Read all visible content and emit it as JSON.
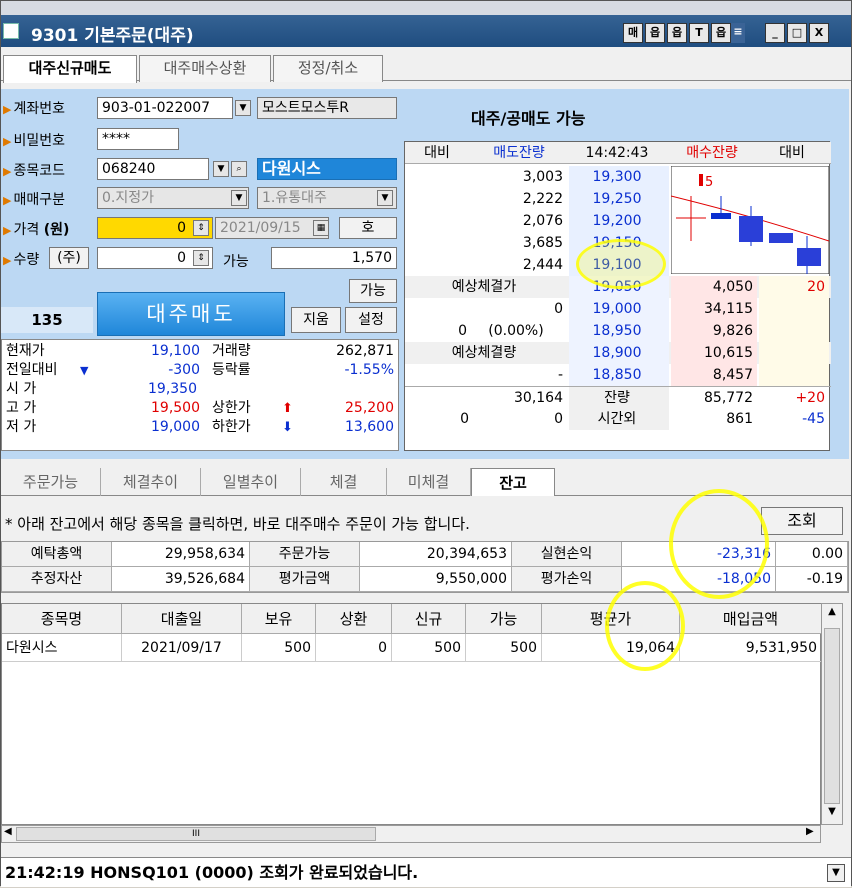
{
  "window": {
    "title": "9301 기본주문(대주)",
    "title_buttons": [
      "매",
      "읍",
      "읍",
      "T",
      "읍",
      "≡",
      "_",
      "□",
      "X"
    ]
  },
  "top_tabs": [
    "대주신규매도",
    "대주매수상환",
    "정정/취소"
  ],
  "form": {
    "account_label": "계좌번호",
    "account_value": "903-01-022007",
    "account_name": "모스트모스투R",
    "password_label": "비밀번호",
    "password_value": "****",
    "code_label": "종목코드",
    "code_value": "068240",
    "stock_name": "다원시스",
    "trade_type_label": "매매구분",
    "trade_type_value": "0.지정가",
    "stock_type_value": "1.유통대주",
    "price_label": "가격",
    "price_unit": "(원)",
    "price_value": "0",
    "date_value": "2021/09/15",
    "ho_label": "호",
    "qty_label": "수량",
    "qty_unit": "(주)",
    "qty_value": "0",
    "avail_label": "가능",
    "avail_value": "1,570",
    "avail_btn": "가능",
    "count_value": "135",
    "sell_btn": "대주매도",
    "clear_btn": "지움",
    "setting_btn": "설정"
  },
  "quote_info": {
    "rows": [
      {
        "label": "현재가",
        "value": "19,100",
        "label2": "거래량",
        "value2": "262,871"
      },
      {
        "label": "전일대비",
        "value": "-300",
        "label2": "등락률",
        "value2": "-1.55%"
      },
      {
        "label": "시  가",
        "value": "19,350",
        "label2": "",
        "value2": ""
      },
      {
        "label": "고  가",
        "value": "19,500",
        "label2": "상한가",
        "value2": "25,200"
      },
      {
        "label": "저  가",
        "value": "19,000",
        "label2": "하한가",
        "value2": "13,600"
      }
    ]
  },
  "orderbook": {
    "title": "대주/공매도 가능",
    "headers": [
      "대비",
      "매도잔량",
      "14:42:43",
      "매수잔량",
      "대비"
    ],
    "asks": [
      {
        "qty": "3,003",
        "price": "19,300"
      },
      {
        "qty": "2,222",
        "price": "19,250"
      },
      {
        "qty": "2,076",
        "price": "19,200"
      },
      {
        "qty": "3,685",
        "price": "19,150"
      },
      {
        "qty": "2,444",
        "price": "19,100"
      }
    ],
    "bids": [
      {
        "price": "19,050",
        "qty": "4,050",
        "diff": "20"
      },
      {
        "price": "19,000",
        "qty": "34,115",
        "diff": ""
      },
      {
        "price": "18,950",
        "qty": "9,826",
        "diff": ""
      },
      {
        "price": "18,900",
        "qty": "10,615",
        "diff": ""
      },
      {
        "price": "18,850",
        "qty": "8,457",
        "diff": ""
      }
    ],
    "exp_price_label": "예상체결가",
    "exp_price_value": "0",
    "exp_change": "0",
    "exp_rate": "(0.00%)",
    "exp_qty_label": "예상체결량",
    "exp_qty_value": "-",
    "ask_total": "30,164",
    "remain_label": "잔량",
    "bid_total": "85,772",
    "bid_total_diff": "+20",
    "after_left": "0",
    "after_mid": "0",
    "after_label": "시간외",
    "after_bid": "861",
    "after_diff": "-45",
    "chart_marker": "5"
  },
  "bottom_tabs": [
    "주문가능",
    "체결추이",
    "일별추이",
    "체결",
    "미체결",
    "잔고"
  ],
  "notice": "* 아래 잔고에서 해당 종목을 클릭하면, 바로 대주매수 주문이 가능 합니다.",
  "query_btn": "조회",
  "summary": {
    "row1": [
      "예탁총액",
      "29,958,634",
      "주문가능",
      "20,394,653",
      "실현손익",
      "",
      "-23,316",
      "0.00"
    ],
    "row2": [
      "추정자산",
      "39,526,684",
      "평가금액",
      "9,550,000",
      "평가손익",
      "",
      "-18,050",
      "-0.19"
    ]
  },
  "holdings": {
    "headers": [
      "종목명",
      "대출일",
      "보유",
      "상환",
      "신규",
      "가능",
      "평균가",
      "매입금액"
    ],
    "rows": [
      [
        "다원시스",
        "2021/09/17",
        "500",
        "0",
        "500",
        "500",
        "19,064",
        "9,531,950"
      ]
    ]
  },
  "scroll": {
    "h_thumb": "III"
  },
  "status_text": "21:42:19 HONSQ101 (0000) 조회가 완료되었습니다."
}
